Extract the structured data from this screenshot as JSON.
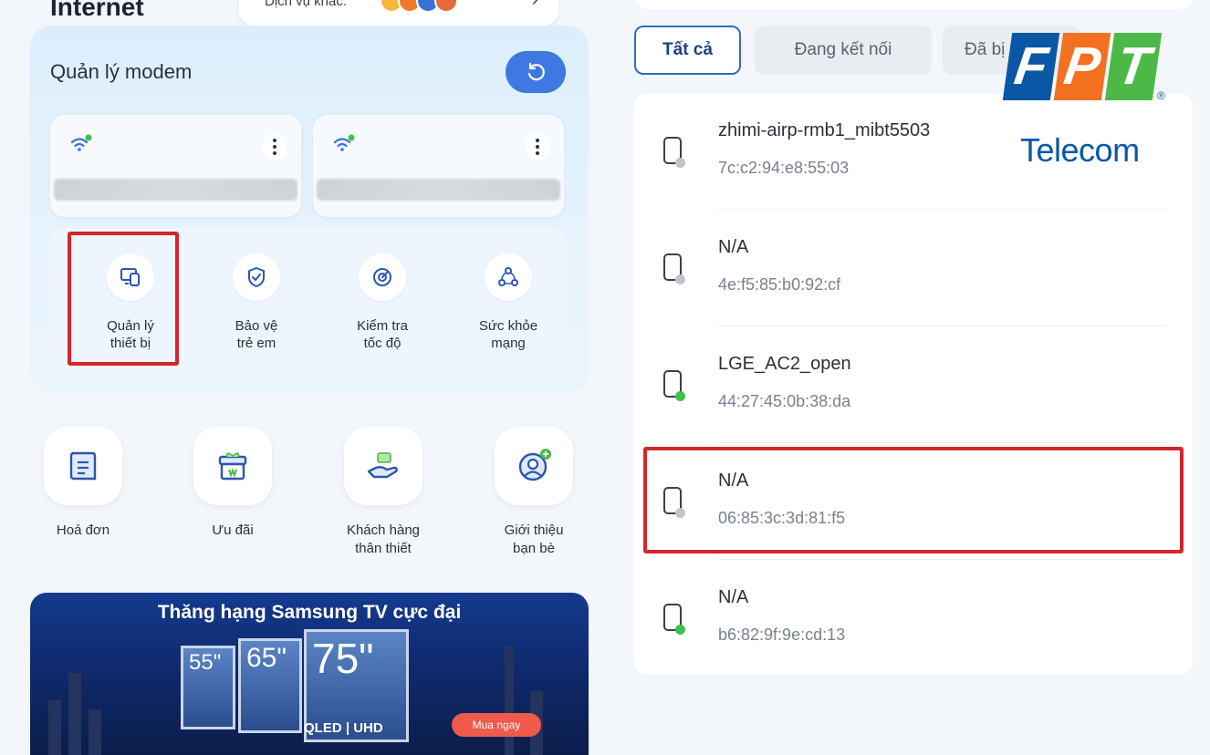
{
  "left": {
    "internet_title": "Internet",
    "other_services_label": "Dịch vụ khác:",
    "modem_title": "Quản lý modem",
    "features": [
      {
        "label_1": "Quản lý",
        "label_2": "thiết bị",
        "icon": "devices-icon"
      },
      {
        "label_1": "Bảo vệ",
        "label_2": "trẻ em",
        "icon": "shield-check-icon"
      },
      {
        "label_1": "Kiểm tra",
        "label_2": "tốc độ",
        "icon": "speedometer-icon"
      },
      {
        "label_1": "Sức khỏe",
        "label_2": "mạng",
        "icon": "network-health-icon"
      }
    ],
    "quick_actions": [
      {
        "label_1": "Hoá đơn",
        "label_2": "",
        "icon": "invoice-icon"
      },
      {
        "label_1": "Ưu đãi",
        "label_2": "",
        "icon": "gift-icon"
      },
      {
        "label_1": "Khách hàng",
        "label_2": "thân thiết",
        "icon": "loyal-customer-icon"
      },
      {
        "label_1": "Giới thiệu",
        "label_2": "bạn bè",
        "icon": "refer-friend-icon"
      }
    ],
    "banner": {
      "headline": "Thăng hạng Samsung TV cực đại",
      "tv_sizes": [
        "55\"",
        "65\"",
        "75\""
      ],
      "qled": "QLED | UHD",
      "cta": "Mua ngay"
    }
  },
  "right": {
    "tabs": [
      "Tất cả",
      "Đang kết nối",
      "Đã bị"
    ],
    "devices": [
      {
        "name": "zhimi-airp-rmb1_mibt5503",
        "mac": "7c:c2:94:e8:55:03",
        "status_color": "#c0c4ca"
      },
      {
        "name": "N/A",
        "mac": "4e:f5:85:b0:92:cf",
        "status_color": "#c0c4ca"
      },
      {
        "name": "LGE_AC2_open",
        "mac": "44:27:45:0b:38:da",
        "status_color": "#3cc24a"
      },
      {
        "name": "N/A",
        "mac": "06:85:3c:3d:81:f5",
        "status_color": "#c0c4ca"
      },
      {
        "name": "N/A",
        "mac": "b6:82:9f:9e:cd:13",
        "status_color": "#3cc24a"
      }
    ]
  },
  "logo": {
    "letters": [
      "F",
      "P",
      "T"
    ],
    "colors": [
      "#0a57a6",
      "#f37021",
      "#4db848"
    ],
    "subtitle": "Telecom",
    "registered": "®"
  },
  "colors": {
    "accent_blue": "#3e78e0",
    "highlight_red": "#d3262b",
    "online_green": "#3cc24a",
    "offline_grey": "#c0c4ca"
  }
}
